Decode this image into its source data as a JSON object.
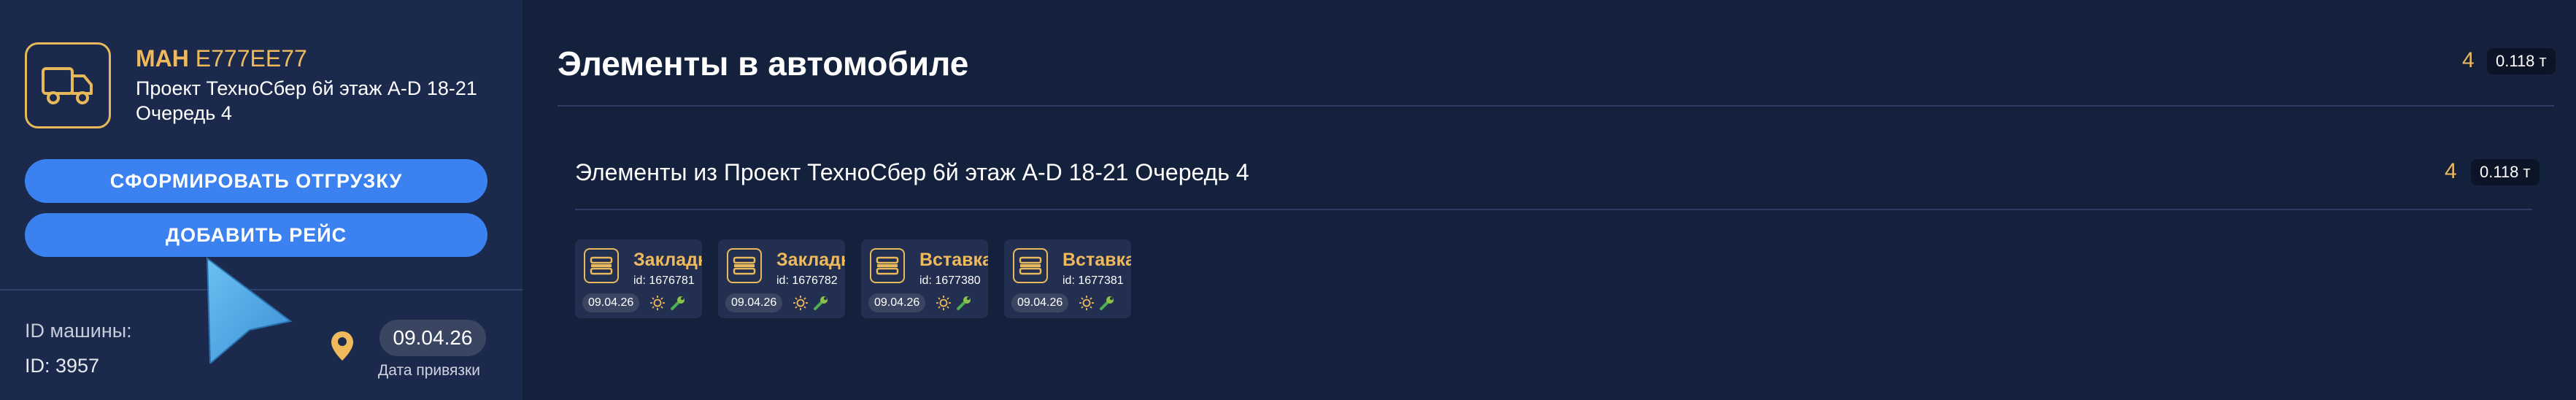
{
  "vehicle": {
    "brand": "МАН",
    "plate": "Е777ЕЕ77",
    "project": "Проект ТехноСбер 6й этаж A-D 18-21 Очередь 4",
    "icon": "truck-icon"
  },
  "actions": {
    "form_shipment": "СФОРМИРОВАТЬ ОТГРУЗКУ",
    "add_trip": "ДОБАВИТЬ РЕЙС"
  },
  "info": {
    "id_label": "ID машины:",
    "id_value": "ID: 3957",
    "bind_date": "09.04.26",
    "bind_caption": "Дата привязки",
    "pin_icon": "location-pin-icon"
  },
  "main": {
    "title": "Элементы в автомобиле",
    "count": "4",
    "weight": "0.118 т",
    "group": {
      "title": "Элементы из Проект ТехноСбер 6й этаж A-D 18-21 Очередь 4",
      "count": "4",
      "weight": "0.118 т"
    },
    "items": [
      {
        "name": "Закладн",
        "id": "id: 1676781",
        "date": "09.04.26"
      },
      {
        "name": "Закладн",
        "id": "id: 1676782",
        "date": "09.04.26"
      },
      {
        "name": "Вставка",
        "id": "id: 1677380",
        "date": "09.04.26"
      },
      {
        "name": "Вставка",
        "id": "id: 1677381",
        "date": "09.04.26"
      }
    ]
  },
  "colors": {
    "accent": "#f0b95c",
    "button": "#3b82f0",
    "background": "#14213d",
    "panel": "#1b2a4c",
    "cursor": "#4fa8e6"
  }
}
